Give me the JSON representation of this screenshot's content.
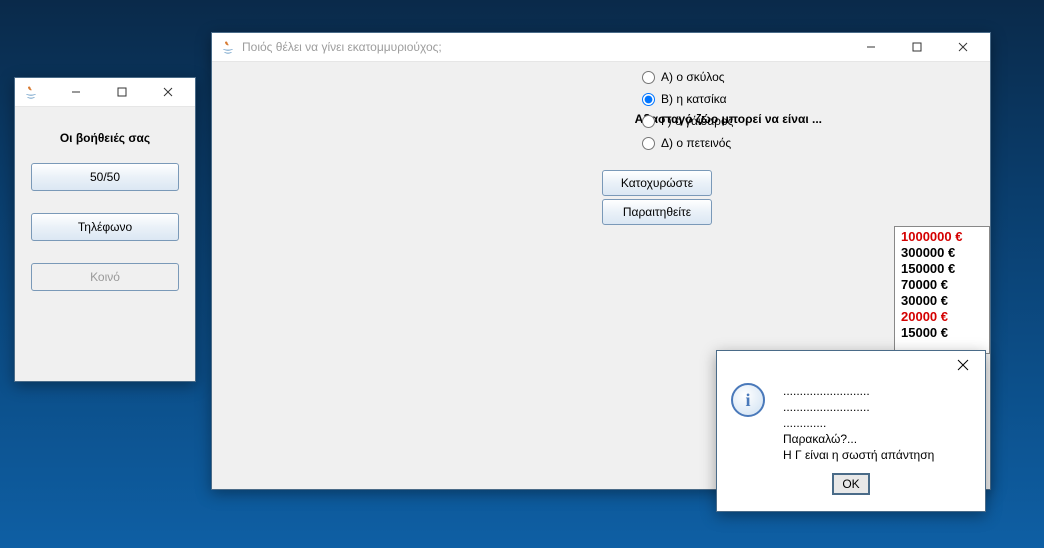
{
  "help_window": {
    "title": "",
    "heading": "Οι βοήθειές σας",
    "buttons": [
      {
        "label": "50/50",
        "enabled": true
      },
      {
        "label": "Τηλέφωνο",
        "enabled": true
      },
      {
        "label": "Κοινό",
        "enabled": false
      }
    ]
  },
  "main_window": {
    "title": "Ποιός θέλει να γίνει εκατομμυριούχος;",
    "question": "Αβασταγό ζώο μπορεί να είναι ...",
    "answers": [
      {
        "letter": "Α",
        "text": "ο σκύλος",
        "selected": false
      },
      {
        "letter": "Β",
        "text": "η κατσίκα",
        "selected": true
      },
      {
        "letter": "Γ",
        "text": "ο γάιδαρος",
        "selected": false
      },
      {
        "letter": "Δ",
        "text": "ο πετεινός",
        "selected": false
      }
    ],
    "action_lock": "Κατοχυρώστε",
    "action_resign": "Παραιτηθείτε",
    "prizes": [
      {
        "value": "1000000 €",
        "highlight": true
      },
      {
        "value": "300000 €",
        "highlight": false
      },
      {
        "value": "150000 €",
        "highlight": false
      },
      {
        "value": "70000 €",
        "highlight": false
      },
      {
        "value": "30000 €",
        "highlight": false
      },
      {
        "value": "20000 €",
        "highlight": true
      },
      {
        "value": "15000 €",
        "highlight": false
      }
    ]
  },
  "dialog": {
    "lines": [
      "..........................",
      "..........................",
      ".............",
      "Παρακαλώ?...",
      "Η Γ είναι η σωστή απάντηση"
    ],
    "ok": "OK"
  }
}
